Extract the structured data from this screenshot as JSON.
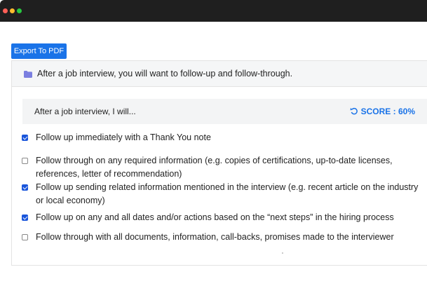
{
  "window": {
    "controls": [
      "close",
      "minimize",
      "maximize"
    ],
    "colors": {
      "close": "#ff5f57",
      "minimize": "#ffbd2e",
      "maximize": "#28c840",
      "titlebar": "#1f1f1f"
    }
  },
  "toolbar": {
    "export_label": "Export To PDF"
  },
  "panel": {
    "icon": "folder-icon",
    "title": "After a job interview, you will want to follow-up and follow-through."
  },
  "question": {
    "prompt": "After a job interview, I will...",
    "score_icon": "undo-icon",
    "score_label": "SCORE : 60%"
  },
  "options": [
    {
      "text": "Follow up immediately with a Thank You note",
      "checked": true
    },
    {
      "text": "Follow through on any required information (e.g. copies of certifications, up-to-date licenses, references, letter of recommendation)",
      "checked": false
    },
    {
      "text": "Follow up sending related information mentioned in the interview (e.g. recent article on the industry or local economy)",
      "checked": true
    },
    {
      "text": "Follow up on any and all dates and/or actions based on the “next steps” in the hiring process",
      "checked": true
    },
    {
      "text": "Follow through with all documents, information, call-backs, promises made to the interviewer",
      "checked": false
    }
  ],
  "colors": {
    "accent": "#1a73e8",
    "checkbox_checked": "#1a56db",
    "folder": "#7b7fe0"
  }
}
